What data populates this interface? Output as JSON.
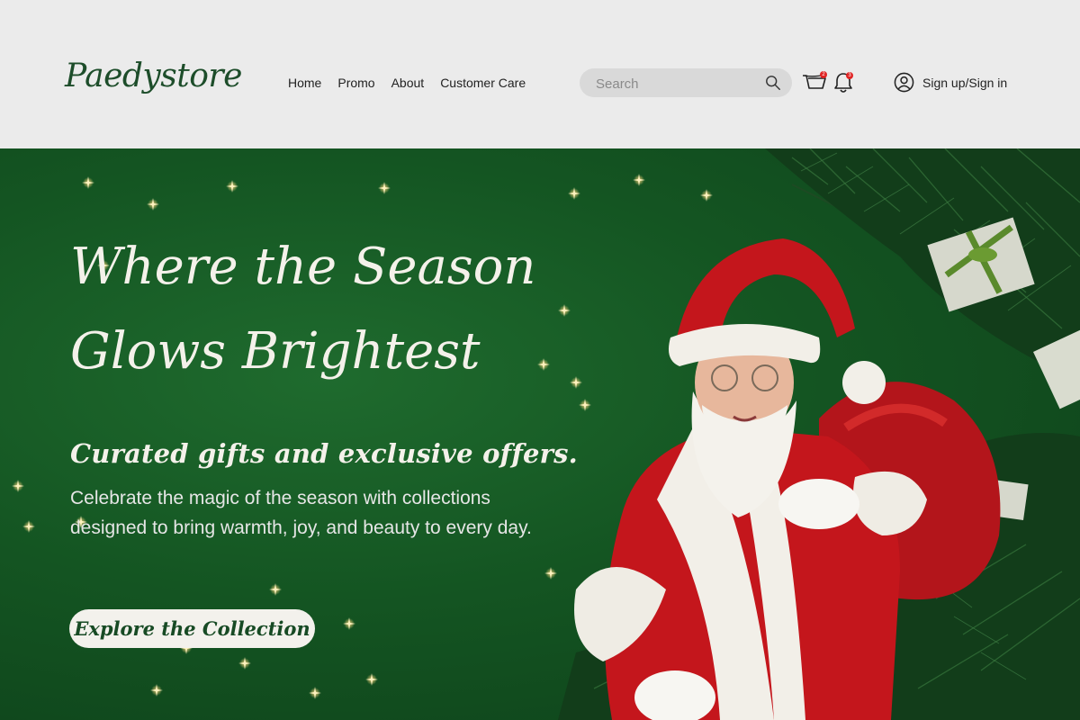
{
  "header": {
    "logo": "Paedystore",
    "nav": [
      "Home",
      "Promo",
      "About",
      "Customer Care"
    ],
    "search": {
      "placeholder": "Search",
      "icon": "search-icon"
    },
    "cart": {
      "icon": "cart-icon",
      "badge": "2"
    },
    "notifications": {
      "icon": "bell-icon",
      "badge": "3"
    },
    "account": {
      "icon": "user-icon",
      "label": "Sign up/Sign in"
    }
  },
  "hero": {
    "title_line1": "Where the Season",
    "title_line2": "Glows Brightest",
    "subtitle": "Curated gifts and exclusive offers.",
    "description": "Celebrate the magic of the season with collections designed to bring warmth, joy, and beauty to every day.",
    "cta_label": "Explore the Collection"
  },
  "colors": {
    "brand_green": "#1d4d2a",
    "hero_green": "#145522",
    "badge_red": "#e02424",
    "cta_bg": "#f3f1ec"
  }
}
